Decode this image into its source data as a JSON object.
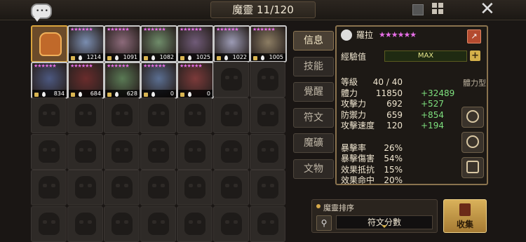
{
  "header": {
    "title": "魔靈 11/120",
    "close_icon": "close-icon",
    "chat_icon": "chat-bubble-icon"
  },
  "monsters": [
    {
      "kind": "selected",
      "value": ""
    },
    {
      "kind": "hero",
      "value": "1214",
      "color": "#7a8db0"
    },
    {
      "kind": "hero",
      "value": "1091",
      "color": "#8c6a7a"
    },
    {
      "kind": "hero",
      "value": "1082",
      "color": "#6f8c6a"
    },
    {
      "kind": "hero",
      "value": "1025",
      "color": "#705b78"
    },
    {
      "kind": "hero",
      "value": "1022",
      "color": "#9c9bb5"
    },
    {
      "kind": "hero",
      "value": "1005",
      "color": "#8c7d63"
    },
    {
      "kind": "hero",
      "value": "834",
      "color": "#4c5880"
    },
    {
      "kind": "hero",
      "value": "684",
      "color": "#6a2c2c"
    },
    {
      "kind": "hero",
      "value": "628",
      "color": "#5a7a55"
    },
    {
      "kind": "hero",
      "value": "0",
      "color": "#5b6f92"
    },
    {
      "kind": "hero",
      "value": "0",
      "color": "#7c3a3a"
    }
  ],
  "tabs": [
    "信息",
    "技能",
    "覺醒",
    "符文",
    "魔礦",
    "文物"
  ],
  "detail": {
    "name": "羅拉",
    "stars": "★★★★★★",
    "exp_label": "經驗值",
    "exp_value": "MAX",
    "exp_fraction": 1.0,
    "type_label": "體力型",
    "stats": [
      {
        "k": "等級",
        "v": "40 / 40",
        "b": ""
      },
      {
        "k": "體力",
        "v": "11850",
        "b": "+32489"
      },
      {
        "k": "攻擊力",
        "v": "692",
        "b": "+527"
      },
      {
        "k": "防禦力",
        "v": "659",
        "b": "+854"
      },
      {
        "k": "攻擊速度",
        "v": "120",
        "b": "+194"
      },
      {
        "k": "",
        "v": "",
        "b": ""
      },
      {
        "k": "暴擊率",
        "v": "26%",
        "b": ""
      },
      {
        "k": "暴擊傷害",
        "v": "54%",
        "b": ""
      },
      {
        "k": "效果抵抗",
        "v": "15%",
        "b": ""
      },
      {
        "k": "效果命中",
        "v": "20%",
        "b": ""
      }
    ]
  },
  "sort": {
    "title": "魔靈排序",
    "value": "符文分數"
  },
  "collect_label": "收集",
  "colors": {
    "accent_gold": "#d4b04a",
    "star_pink": "#e86fe8",
    "bonus_green": "#7ee07e"
  }
}
